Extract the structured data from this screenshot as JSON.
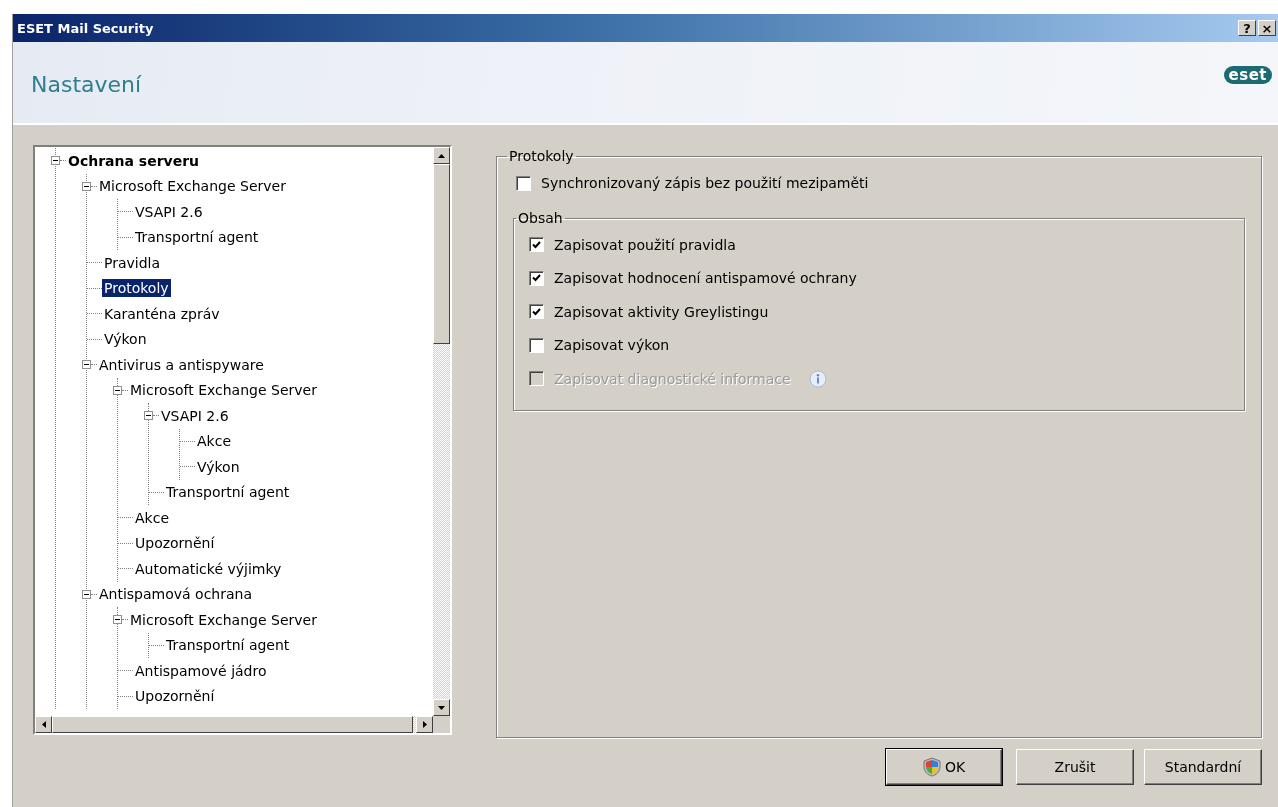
{
  "window": {
    "title": "ESET Mail Security",
    "title_buttons": [
      "?",
      "×"
    ]
  },
  "header": {
    "title": "Nastavení",
    "logo": "eset"
  },
  "tree": [
    {
      "label": "Ochrana serveru",
      "selected": false,
      "expanded": true,
      "children": [
        {
          "label": "Microsoft Exchange Server",
          "selected": false,
          "expanded": true,
          "children": [
            {
              "label": "VSAPI 2.6",
              "selected": false
            },
            {
              "label": "Transportní agent",
              "selected": false
            }
          ]
        },
        {
          "label": "Pravidla",
          "selected": false
        },
        {
          "label": "Protokoly",
          "selected": true
        },
        {
          "label": "Karanténa zpráv",
          "selected": false
        },
        {
          "label": "Výkon",
          "selected": false
        },
        {
          "label": "Antivirus a antispyware",
          "selected": false,
          "expanded": true,
          "children": [
            {
              "label": "Microsoft Exchange Server",
              "selected": false,
              "expanded": true,
              "children": [
                {
                  "label": "VSAPI 2.6",
                  "selected": false,
                  "expanded": true,
                  "children": [
                    {
                      "label": "Akce",
                      "selected": false
                    },
                    {
                      "label": "Výkon",
                      "selected": false
                    }
                  ]
                },
                {
                  "label": "Transportní agent",
                  "selected": false
                }
              ]
            },
            {
              "label": "Akce",
              "selected": false
            },
            {
              "label": "Upozornění",
              "selected": false
            },
            {
              "label": "Automatické výjimky",
              "selected": false
            }
          ]
        },
        {
          "label": "Antispamová ochrana",
          "selected": false,
          "expanded": true,
          "children": [
            {
              "label": "Microsoft Exchange Server",
              "selected": false,
              "expanded": true,
              "children": [
                {
                  "label": "Transportní agent",
                  "selected": false
                }
              ]
            },
            {
              "label": "Antispamové jádro",
              "selected": false
            },
            {
              "label": "Upozornění",
              "selected": false
            }
          ]
        }
      ]
    }
  ],
  "settings": {
    "title": "Protokoly",
    "options": [
      {
        "label": "Synchronizovaný zápis bez použití mezipaměti",
        "checked": false,
        "disabled": false,
        "info": false
      }
    ],
    "group": {
      "title": "Obsah",
      "options": [
        {
          "label": "Zapisovat použití pravidla",
          "checked": true,
          "disabled": false,
          "info": false
        },
        {
          "label": "Zapisovat hodnocení antispamové ochrany",
          "checked": true,
          "disabled": false,
          "info": false
        },
        {
          "label": "Zapisovat aktivity Greylistingu",
          "checked": true,
          "disabled": false,
          "info": false
        },
        {
          "label": "Zapisovat výkon",
          "checked": false,
          "disabled": false,
          "info": false
        },
        {
          "label": "Zapisovat diagnostické informace",
          "checked": false,
          "disabled": true,
          "info": true
        }
      ]
    }
  },
  "buttons": [
    {
      "label": "OK",
      "default": true,
      "shield": true
    },
    {
      "label": "Zrušit",
      "default": false,
      "shield": false
    },
    {
      "label": "Standardní",
      "default": false,
      "shield": false
    }
  ]
}
